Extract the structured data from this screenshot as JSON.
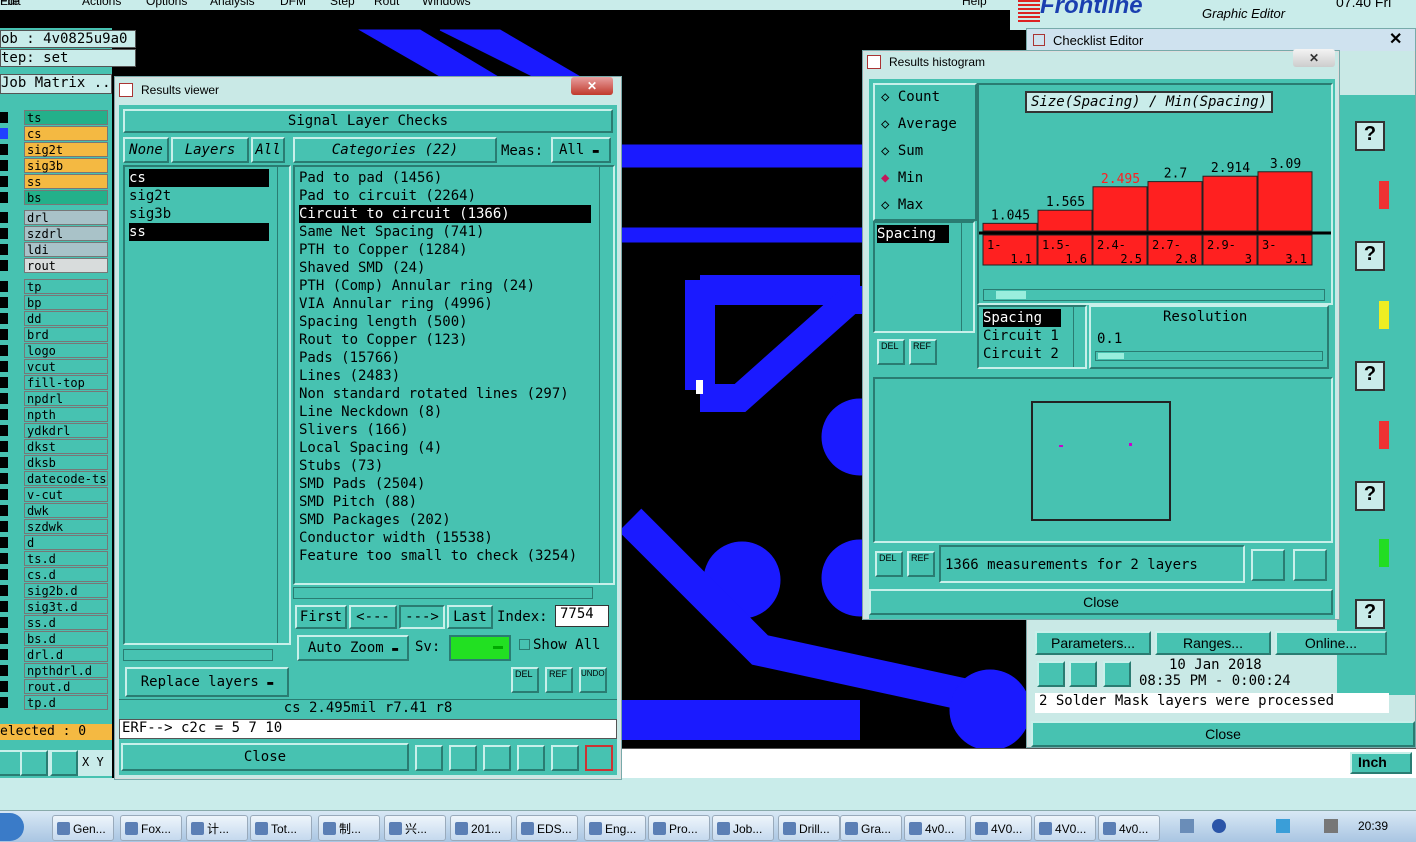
{
  "menubar": {
    "items": [
      "File",
      "Edit",
      "Actions",
      "Options",
      "Analysis",
      "DFM",
      "Step",
      "Rout",
      "Windows"
    ],
    "help": "Help",
    "logo": "Frontline",
    "logo_sub": "Graphic Editor",
    "version": "07.40 Fri"
  },
  "job": {
    "job_label": "ob : 4v0825u9a0",
    "step_label": "tep: set",
    "matrix_label": "Job Matrix ..",
    "selected_label": "elected : 0",
    "xy_label": "X Y"
  },
  "layers": [
    {
      "name": "ts",
      "color": "#23b08a"
    },
    {
      "name": "cs",
      "color": "#f4b942",
      "active": true
    },
    {
      "name": "sig2t",
      "color": "#f4b942"
    },
    {
      "name": "sig3b",
      "color": "#f4b942"
    },
    {
      "name": "ss",
      "color": "#f4b942"
    },
    {
      "name": "bs",
      "color": "#23b08a"
    },
    {
      "name": "drl",
      "color": "#a9c2c8"
    },
    {
      "name": "szdrl",
      "color": "#a9c2c8"
    },
    {
      "name": "ldi",
      "color": "#a9c2c8"
    },
    {
      "name": "rout",
      "color": "#d8dcdc"
    },
    {
      "name": "tp",
      "color": "#47c2b1"
    },
    {
      "name": "bp",
      "color": "#47c2b1"
    },
    {
      "name": "dd",
      "color": "#47c2b1"
    },
    {
      "name": "brd",
      "color": "#47c2b1"
    },
    {
      "name": "logo",
      "color": "#47c2b1"
    },
    {
      "name": "vcut",
      "color": "#47c2b1"
    },
    {
      "name": "fill-top",
      "color": "#47c2b1"
    },
    {
      "name": "npdrl",
      "color": "#47c2b1"
    },
    {
      "name": "npth",
      "color": "#47c2b1"
    },
    {
      "name": "ydkdrl",
      "color": "#47c2b1"
    },
    {
      "name": "dkst",
      "color": "#47c2b1"
    },
    {
      "name": "dksb",
      "color": "#47c2b1"
    },
    {
      "name": "datecode-ts",
      "color": "#47c2b1"
    },
    {
      "name": "v-cut",
      "color": "#47c2b1"
    },
    {
      "name": "dwk",
      "color": "#47c2b1"
    },
    {
      "name": "szdwk",
      "color": "#47c2b1"
    },
    {
      "name": "d",
      "color": "#47c2b1"
    },
    {
      "name": "ts.d",
      "color": "#47c2b1"
    },
    {
      "name": "cs.d",
      "color": "#47c2b1"
    },
    {
      "name": "sig2b.d",
      "color": "#47c2b1"
    },
    {
      "name": "sig3t.d",
      "color": "#47c2b1"
    },
    {
      "name": "ss.d",
      "color": "#47c2b1"
    },
    {
      "name": "bs.d",
      "color": "#47c2b1"
    },
    {
      "name": "drl.d",
      "color": "#47c2b1"
    },
    {
      "name": "npthdrl.d",
      "color": "#47c2b1"
    },
    {
      "name": "rout.d",
      "color": "#47c2b1"
    },
    {
      "name": "tp.d",
      "color": "#47c2b1"
    }
  ],
  "viewer": {
    "title": "Results viewer",
    "header": "Signal Layer Checks",
    "none_btn": "None",
    "layers_btn": "Layers",
    "all_btn": "All",
    "categories_btn": "Categories (22)",
    "meas_label": "Meas:",
    "meas_value": "All",
    "layer_items": [
      "cs",
      "sig2t",
      "sig3b",
      "ss"
    ],
    "categories": [
      "Pad to pad (1456)",
      "Pad to circuit (2264)",
      "Circuit to circuit (1366)",
      "Same Net Spacing (741)",
      "PTH to Copper (1284)",
      "Shaved SMD (24)",
      "PTH (Comp) Annular ring (24)",
      "VIA Annular ring (4996)",
      "Spacing length (500)",
      "Rout to Copper (123)",
      "Pads (15766)",
      "Lines (2483)",
      "Non standard rotated lines (297)",
      "Line Neckdown (8)",
      "Slivers (166)",
      "Local Spacing (4)",
      "Stubs (73)",
      "SMD Pads (2504)",
      "SMD Pitch (88)",
      "SMD Packages (202)",
      "Conductor width (15538)",
      "Feature too small to check (3254)"
    ],
    "first_btn": "First",
    "prev_btn": "<---",
    "next_btn": "--->",
    "last_btn": "Last",
    "index_label": "Index:",
    "index_value": "7754",
    "autozoom_btn": "Auto Zoom",
    "sv_label": "Sv:",
    "showall_label": "Show All",
    "replace_btn": "Replace layers",
    "del_btn": "DEL",
    "ref_btn": "REF",
    "undo_btn": "UNDO",
    "status": "cs 2.495mil  r7.41  r8",
    "erf": "ERF--> c2c = 5 7 10",
    "close_btn": "Close"
  },
  "histogram": {
    "title": "Results histogram",
    "options": [
      "Count",
      "Average",
      "Sum",
      "Min",
      "Max"
    ],
    "selected_option": "Min",
    "chart_title": "Size(Spacing) / Min(Spacing)",
    "list_item": "Spacing",
    "cols": [
      "Spacing",
      "Circuit 1",
      "Circuit 2"
    ],
    "resolution_label": "Resolution",
    "resolution_value": "0.1",
    "del_btn": "DEL",
    "ref_btn": "REF",
    "measure_text": "1366 measurements for 2 layers",
    "close_btn": "Close"
  },
  "chart_data": {
    "type": "bar",
    "title": "Size(Spacing) / Min(Spacing)",
    "categories": [
      "1-1.1",
      "1.5-1.6",
      "2.4-2.5",
      "2.7-2.8",
      "2.9-3",
      "3-3.1"
    ],
    "values": [
      1.045,
      1.565,
      2.495,
      2.7,
      2.914,
      3.09
    ],
    "value_labels": [
      "1.045",
      "1.565",
      "2.495",
      "2.7",
      "2.914",
      "3.09"
    ],
    "highlight_index": 2,
    "bar_color": "#ff2020",
    "highlight_label_color": "#ff2020"
  },
  "checklist": {
    "title": "Checklist Editor",
    "params_btn": "Parameters...",
    "ranges_btn": "Ranges...",
    "online_btn": "Online...",
    "date": "10 Jan 2018",
    "time": "08:35 PM - 0:00:24",
    "message": "2 Solder Mask layers were processed",
    "close_btn": "Close",
    "units": "Inch"
  },
  "taskbar": {
    "items": [
      "Gen...",
      "Fox...",
      "计...",
      "Tot...",
      "制...",
      "兴...",
      "201...",
      "EDS...",
      "Eng...",
      "Pro...",
      "Job...",
      "Drill...",
      "Gra...",
      "4v0...",
      "4V0...",
      "4V0...",
      "4v0..."
    ],
    "clock": "20:39"
  }
}
